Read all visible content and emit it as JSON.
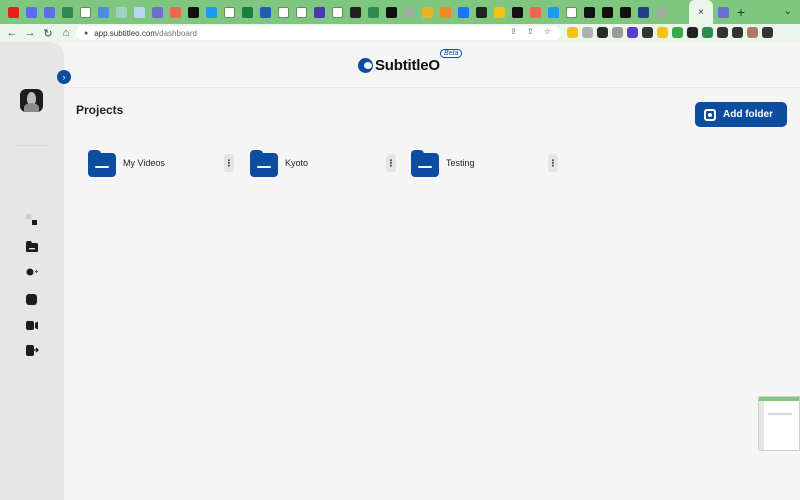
{
  "browser": {
    "tabs": [
      {
        "icon": "youtube-icon",
        "color": "#e62117"
      },
      {
        "icon": "s-icon",
        "color": "#5b6ee8"
      },
      {
        "icon": "s-icon",
        "color": "#5b6ee8"
      },
      {
        "icon": "leaf-icon",
        "color": "#2f8a4f"
      },
      {
        "icon": "google-icon",
        "color": "#ffffff"
      },
      {
        "icon": "grid-icon",
        "color": "#4d8fd6"
      },
      {
        "icon": "wave-icon",
        "color": "#9fd0c4"
      },
      {
        "icon": "cloud-icon",
        "color": "#b9d7ef"
      },
      {
        "icon": "edit-icon",
        "color": "#6d6fd1"
      },
      {
        "icon": "p-icon",
        "color": "#e86b4f"
      },
      {
        "icon": "n-icon",
        "color": "#111111"
      },
      {
        "icon": "twitter-icon",
        "color": "#1d9bf0"
      },
      {
        "icon": "google-icon",
        "color": "#ffffff"
      },
      {
        "icon": "plus-icon",
        "color": "#1a7f3c"
      },
      {
        "icon": "pen-icon",
        "color": "#1d5fb8"
      },
      {
        "icon": "google-icon",
        "color": "#ffffff"
      },
      {
        "icon": "google-icon",
        "color": "#ffffff"
      },
      {
        "icon": "app-icon",
        "color": "#4a3aa8"
      },
      {
        "icon": "google-icon",
        "color": "#ffffff"
      },
      {
        "icon": "chrome-icon",
        "color": "#222222"
      },
      {
        "icon": "leaf-icon",
        "color": "#2f8a4f"
      },
      {
        "icon": "openai-icon",
        "color": "#111111"
      },
      {
        "icon": "openai-icon",
        "color": "#9ab39a"
      },
      {
        "icon": "s-icon",
        "color": "#e9b41f"
      },
      {
        "icon": "play-icon",
        "color": "#f08a24"
      },
      {
        "icon": "facebook-icon",
        "color": "#1877f2"
      },
      {
        "icon": "b-icon",
        "color": "#222222"
      },
      {
        "icon": "list-icon",
        "color": "#f2c314"
      },
      {
        "icon": "c-icon",
        "color": "#111111"
      },
      {
        "icon": "p-icon",
        "color": "#e86b4f"
      },
      {
        "icon": "twitter-icon",
        "color": "#1d9bf0"
      },
      {
        "icon": "google-icon",
        "color": "#ffffff"
      },
      {
        "icon": "x-icon",
        "color": "#111111"
      },
      {
        "icon": "terminal-icon",
        "color": "#111111"
      },
      {
        "icon": "x-icon",
        "color": "#111111"
      },
      {
        "icon": "news-icon",
        "color": "#1f3f8a"
      },
      {
        "icon": "openai-icon",
        "color": "#9ab39a"
      },
      {
        "icon": "leaf-icon",
        "color": "#7fc77f"
      }
    ],
    "active_tab_close": "×",
    "trailing_tab": {
      "icon": "slides-icon",
      "color": "#6d6fd1"
    },
    "new_tab_label": "+",
    "tab_menu_label": "⌄",
    "url_host": "app.subtitleo.com",
    "url_path": "/dashboard",
    "nav": {
      "back": "←",
      "forward": "→",
      "reload": "↻",
      "home": "⌂"
    },
    "omnibox_actions": "⇪ ⇧ ☆",
    "extensions": [
      {
        "icon": "ext-yellow-icon",
        "color": "#f2c314"
      },
      {
        "icon": "ext-grid-icon",
        "color": "#b0b0b0"
      },
      {
        "icon": "ext-dark-icon",
        "color": "#2a2a2a"
      },
      {
        "icon": "ext-openai-icon",
        "color": "#9a9a9a"
      },
      {
        "icon": "ext-puzzle-purple-icon",
        "color": "#5b3ad1"
      },
      {
        "icon": "ext-dot-icon",
        "color": "#333333"
      },
      {
        "icon": "ext-badge-icon",
        "color": "#f2c314"
      },
      {
        "icon": "ext-green-icon",
        "color": "#3aa84a"
      },
      {
        "icon": "ext-dark-icon",
        "color": "#222222"
      },
      {
        "icon": "ext-green-icon",
        "color": "#2f8a4f"
      },
      {
        "icon": "puzzle-icon",
        "color": "#333333"
      },
      {
        "icon": "sidepanel-icon",
        "color": "#333333"
      },
      {
        "icon": "profile-icon",
        "color": "#b07a6a"
      },
      {
        "icon": "more-icon",
        "color": "#333333"
      }
    ]
  },
  "app": {
    "logo_text": "SubtitleO",
    "beta_label": "Beta",
    "page_title": "Projects",
    "add_folder_label": "Add folder",
    "collapse_glyph": "›",
    "kebab_glyph": "⋮",
    "brand_color": "#0d4da0",
    "sidebar_icons": [
      "dashboard-icon",
      "folder-icon",
      "add-user-icon",
      "square-icon",
      "video-icon",
      "logout-icon"
    ],
    "folders": [
      {
        "name": "My Videos"
      },
      {
        "name": "Kyoto"
      },
      {
        "name": "Testing"
      }
    ]
  }
}
